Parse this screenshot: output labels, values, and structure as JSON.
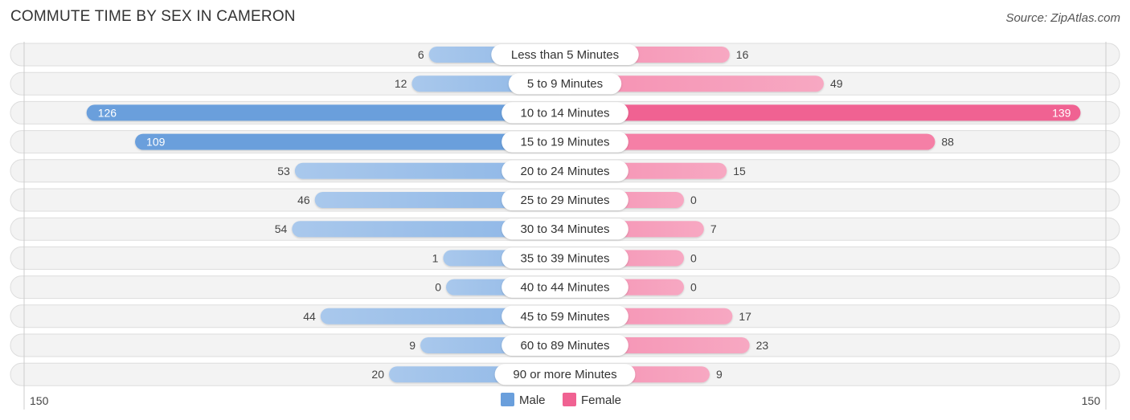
{
  "chart_data": {
    "type": "bar",
    "orientation": "horizontal-diverging",
    "title": "COMMUTE TIME BY SEX IN CAMERON",
    "source": "Source: ZipAtlas.com",
    "categories": [
      "Less than 5 Minutes",
      "5 to 9 Minutes",
      "10 to 14 Minutes",
      "15 to 19 Minutes",
      "20 to 24 Minutes",
      "25 to 29 Minutes",
      "30 to 34 Minutes",
      "35 to 39 Minutes",
      "40 to 44 Minutes",
      "45 to 59 Minutes",
      "60 to 89 Minutes",
      "90 or more Minutes"
    ],
    "series": [
      {
        "name": "Male",
        "color": "#6a9fdc",
        "values": [
          6,
          12,
          126,
          109,
          53,
          46,
          54,
          1,
          0,
          44,
          9,
          20
        ]
      },
      {
        "name": "Female",
        "color": "#f06292",
        "values": [
          16,
          49,
          139,
          88,
          15,
          0,
          7,
          0,
          0,
          17,
          23,
          9
        ]
      }
    ],
    "axis": {
      "left_tick": "150",
      "right_tick": "150",
      "max": 150
    },
    "legend": {
      "position": "bottom-center",
      "items": [
        "Male",
        "Female"
      ]
    },
    "grid": false
  }
}
